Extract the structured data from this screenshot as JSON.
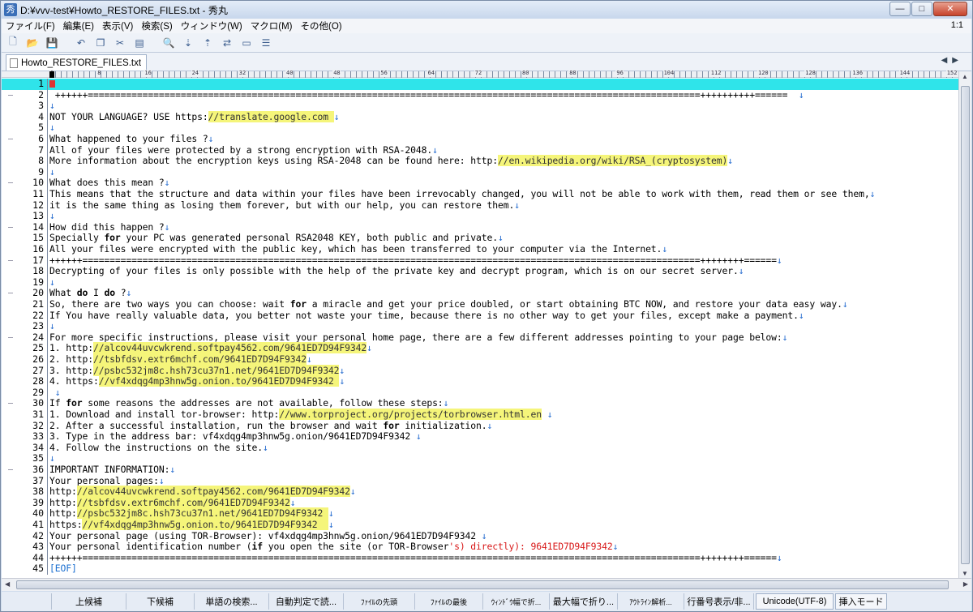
{
  "window": {
    "title": "D:¥vvv-test¥Howto_RESTORE_FILES.txt - 秀丸",
    "app_icon": "秀",
    "buttons": {
      "minimize": "—",
      "maximize": "□",
      "close": "✕"
    }
  },
  "menu": {
    "items": [
      "ファイル(F)",
      "編集(E)",
      "表示(V)",
      "検索(S)",
      "ウィンドウ(W)",
      "マクロ(M)",
      "その他(O)"
    ],
    "position": "1:1"
  },
  "toolbar": {
    "icons": [
      "new-file-icon",
      "open-folder-icon",
      "save-icon",
      "undo-icon",
      "copy-icon",
      "cut-icon",
      "paste-icon",
      "search-icon",
      "search-down-icon",
      "search-up-icon",
      "replace-icon",
      "grep-icon",
      "window-split-icon"
    ]
  },
  "tab": {
    "label": "Howto_RESTORE_FILES.txt"
  },
  "ruler": {
    "labels": [
      "0",
      "8",
      "16",
      "24",
      "32",
      "40",
      "48",
      "56",
      "64",
      "72",
      "80",
      "88",
      "96",
      "104",
      "112",
      "120",
      "128",
      "136",
      "144",
      "152"
    ]
  },
  "editor": {
    "lines": [
      {
        "n": "1",
        "segs": [],
        "cursor": true,
        "eol": false
      },
      {
        "n": "2",
        "segs": [
          {
            "t": " ++++++================================================================================================================++++++++++======  "
          }
        ],
        "eol": true
      },
      {
        "n": "3",
        "segs": [],
        "eol": true
      },
      {
        "n": "4",
        "segs": [
          {
            "t": "NOT YOUR LANGUAGE? USE https:"
          },
          {
            "t": "//translate.google.com ",
            "c": "hl"
          }
        ],
        "eol": true
      },
      {
        "n": "5",
        "segs": [],
        "eol": true
      },
      {
        "n": "6",
        "segs": [
          {
            "t": "What happened to your files ?"
          }
        ],
        "eol": true
      },
      {
        "n": "7",
        "segs": [
          {
            "t": "All of your files were protected by a strong encryption with RSA-2048."
          }
        ],
        "eol": true
      },
      {
        "n": "8",
        "segs": [
          {
            "t": "More information about the encryption keys using RSA-2048 can be found here: http:"
          },
          {
            "t": "//en.wikipedia.org/wiki/RSA_(cryptosystem)",
            "c": "hl"
          }
        ],
        "eol": true
      },
      {
        "n": "9",
        "segs": [],
        "eol": true
      },
      {
        "n": "10",
        "segs": [
          {
            "t": "What does this mean ?"
          }
        ],
        "eol": true
      },
      {
        "n": "11",
        "segs": [
          {
            "t": "This means that the structure and data within your files have been irrevocably changed, you will not be able to work with them, read them or see them,"
          }
        ],
        "eol": true
      },
      {
        "n": "12",
        "segs": [
          {
            "t": "it is the same thing as losing them forever, but with our help, you can restore them."
          }
        ],
        "eol": true
      },
      {
        "n": "13",
        "segs": [],
        "eol": true
      },
      {
        "n": "14",
        "segs": [
          {
            "t": "How did this happen ?"
          }
        ],
        "eol": true
      },
      {
        "n": "15",
        "segs": [
          {
            "t": "Specially "
          },
          {
            "t": "for",
            "c": "b"
          },
          {
            "t": " your PC was generated personal RSA2048 KEY, both public and private."
          }
        ],
        "eol": true
      },
      {
        "n": "16",
        "segs": [
          {
            "t": "All your files were encrypted with the public key, which has been transferred to your computer via the Internet."
          }
        ],
        "eol": true
      },
      {
        "n": "17",
        "segs": [
          {
            "t": "++++++=================================================================================================================++++++++======"
          }
        ],
        "eol": true
      },
      {
        "n": "18",
        "segs": [
          {
            "t": "Decrypting of your files is only possible with the help of the private key and decrypt program, which is on our secret server."
          }
        ],
        "eol": true
      },
      {
        "n": "19",
        "segs": [],
        "eol": true
      },
      {
        "n": "20",
        "segs": [
          {
            "t": "What "
          },
          {
            "t": "do",
            "c": "b"
          },
          {
            "t": " I "
          },
          {
            "t": "do",
            "c": "b"
          },
          {
            "t": " ?"
          }
        ],
        "eol": true
      },
      {
        "n": "21",
        "segs": [
          {
            "t": "So, there are two ways you can choose: wait "
          },
          {
            "t": "for",
            "c": "b"
          },
          {
            "t": " a miracle and get your price doubled, or start obtaining BTC NOW, and restore your data easy way."
          }
        ],
        "eol": true
      },
      {
        "n": "22",
        "segs": [
          {
            "t": "If You have really valuable data, you better not waste your time, because there is no other way to get your files, except make a payment."
          }
        ],
        "eol": true
      },
      {
        "n": "23",
        "segs": [],
        "eol": true
      },
      {
        "n": "24",
        "segs": [
          {
            "t": "For more specific instructions, please visit your personal home page, there are a few different addresses pointing to your page below:"
          }
        ],
        "eol": true
      },
      {
        "n": "25",
        "segs": [
          {
            "t": "1. http:"
          },
          {
            "t": "//alcov44uvcwkrend.softpay4562.com/9641ED7D94F9342",
            "c": "hl"
          }
        ],
        "eol": true
      },
      {
        "n": "26",
        "segs": [
          {
            "t": "2. http:"
          },
          {
            "t": "//tsbfdsv.extr6mchf.com/9641ED7D94F9342",
            "c": "hl"
          }
        ],
        "eol": true
      },
      {
        "n": "27",
        "segs": [
          {
            "t": "3. http:"
          },
          {
            "t": "//psbc532jm8c.hsh73cu37n1.net/9641ED7D94F9342",
            "c": "hl"
          }
        ],
        "eol": true
      },
      {
        "n": "28",
        "segs": [
          {
            "t": "4. https:"
          },
          {
            "t": "//vf4xdqg4mp3hnw5g.onion.to/9641ED7D94F9342 ",
            "c": "hl"
          }
        ],
        "eol": true
      },
      {
        "n": "29",
        "segs": [
          {
            "t": " "
          }
        ],
        "eol": true
      },
      {
        "n": "30",
        "segs": [
          {
            "t": "If "
          },
          {
            "t": "for",
            "c": "b"
          },
          {
            "t": " some reasons the addresses are not available, follow these steps:"
          }
        ],
        "eol": true
      },
      {
        "n": "31",
        "segs": [
          {
            "t": "1. Download and install tor-browser: http:"
          },
          {
            "t": "//www.torproject.org/projects/torbrowser.html.en",
            "c": "hl"
          },
          {
            "t": " "
          }
        ],
        "eol": true
      },
      {
        "n": "32",
        "segs": [
          {
            "t": "2. After a successful installation, run the browser and wait "
          },
          {
            "t": "for",
            "c": "b"
          },
          {
            "t": " initialization."
          }
        ],
        "eol": true
      },
      {
        "n": "33",
        "segs": [
          {
            "t": "3. Type in the address bar: vf4xdqg4mp3hnw5g.onion/9641ED7D94F9342 "
          }
        ],
        "eol": true
      },
      {
        "n": "34",
        "segs": [
          {
            "t": "4. Follow the instructions on the site."
          }
        ],
        "eol": true
      },
      {
        "n": "35",
        "segs": [],
        "eol": true
      },
      {
        "n": "36",
        "segs": [
          {
            "t": "IMPORTANT INFORMATION:"
          }
        ],
        "eol": true
      },
      {
        "n": "37",
        "segs": [
          {
            "t": "Your personal pages:"
          }
        ],
        "eol": true
      },
      {
        "n": "38",
        "segs": [
          {
            "t": "http:"
          },
          {
            "t": "//alcov44uvcwkrend.softpay4562.com/9641ED7D94F9342",
            "c": "hl"
          }
        ],
        "eol": true
      },
      {
        "n": "39",
        "segs": [
          {
            "t": "http:"
          },
          {
            "t": "//tsbfdsv.extr6mchf.com/9641ED7D94F9342",
            "c": "hl"
          }
        ],
        "eol": true
      },
      {
        "n": "40",
        "segs": [
          {
            "t": "http:"
          },
          {
            "t": "//psbc532jm8c.hsh73cu37n1.net/9641ED7D94F9342 ",
            "c": "hl"
          }
        ],
        "eol": true
      },
      {
        "n": "41",
        "segs": [
          {
            "t": "https:"
          },
          {
            "t": "//vf4xdqg4mp3hnw5g.onion.to/9641ED7D94F9342  ",
            "c": "hl"
          }
        ],
        "eol": true
      },
      {
        "n": "42",
        "segs": [
          {
            "t": "Your personal page (using TOR-Browser): vf4xdqg4mp3hnw5g.onion/9641ED7D94F9342 "
          }
        ],
        "eol": true
      },
      {
        "n": "43",
        "segs": [
          {
            "t": "Your personal identification number ("
          },
          {
            "t": "if",
            "c": "b"
          },
          {
            "t": " you open the site (or TOR-Browser"
          },
          {
            "t": "'s) directly): 9641ED7D94F9342",
            "c": "red"
          }
        ],
        "eol": true
      },
      {
        "n": "44",
        "segs": [
          {
            "t": "++++++=================================================================================================================++++++++======"
          }
        ],
        "eol": true
      },
      {
        "n": "45",
        "segs": [
          {
            "t": "[EOF]",
            "c": "eof"
          }
        ],
        "eol": false
      }
    ]
  },
  "funcbar": {
    "keys": [
      "",
      "上候補",
      "下候補",
      "単語の検索...",
      "自動判定で読...",
      "ﾌｧｲﾙの先頭",
      "ﾌｧｲﾙの最後",
      "ｳｨﾝﾄﾞｳ幅で折...",
      "最大幅で折り...",
      "ｱｳﾄﾗｲﾝ解析...",
      "行番号表示/非..."
    ],
    "encoding": "Unicode(UTF-8)",
    "mode": "挿入モード"
  }
}
